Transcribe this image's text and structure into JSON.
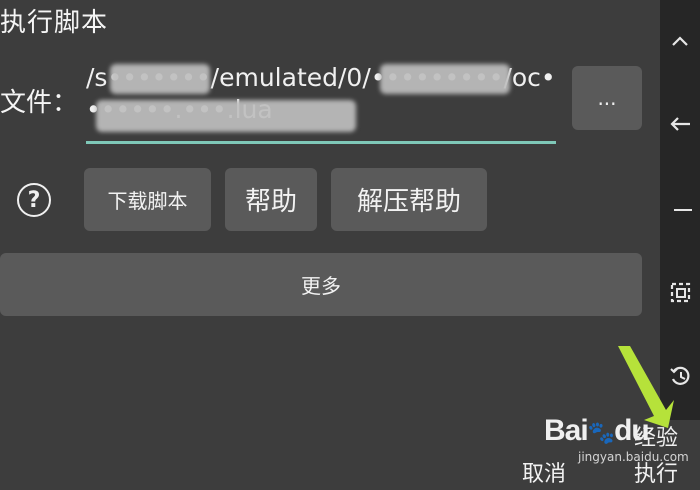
{
  "dialog": {
    "title": "执行脚本",
    "file_label": "文件：",
    "file_path": "/s•••••••/emulated/0/•••••••••/oc•••••••.•••.lua",
    "browse_label": "...",
    "help_icon": "question-circle-icon",
    "buttons": {
      "download": "下载脚本",
      "help": "帮助",
      "unzip_help": "解压帮助",
      "more": "更多"
    },
    "actions": {
      "cancel": "取消",
      "execute": "执行"
    },
    "accent_color": "#7fc8b8"
  },
  "side_bar": {
    "icons": [
      "chevron-up-icon",
      "arrow-left-icon",
      "minus-icon",
      "select-square-icon",
      "history-icon"
    ]
  },
  "watermark": {
    "brand": "Bai☺​",
    "brand_text": "Bai",
    "brand_du": "du",
    "sub": "经验",
    "url": "jingyan.baidu.com"
  }
}
